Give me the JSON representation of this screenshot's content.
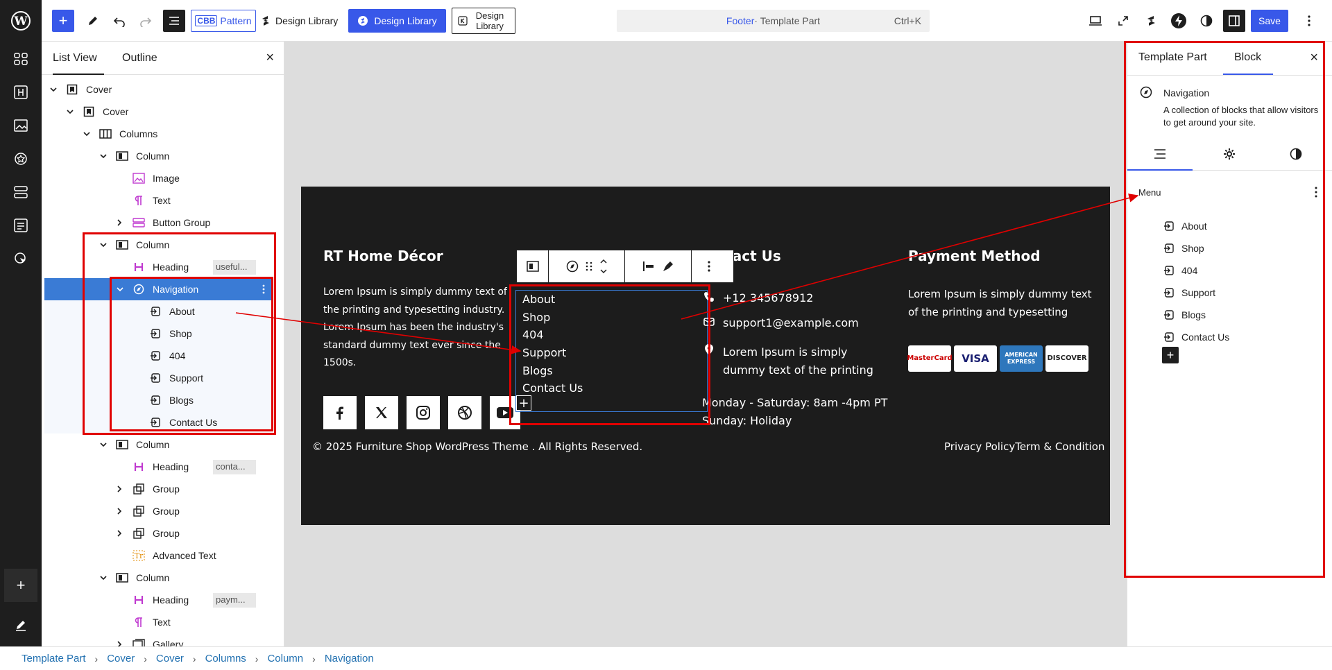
{
  "topbar": {
    "pattern_label": "Pattern",
    "pattern_badge": "CBB",
    "design_library_1": "Design Library",
    "design_library_2": "Design Library",
    "design_library_3": "Design Library",
    "command_template": "Footer",
    "command_suffix": " · Template Part",
    "command_shortcut": "Ctrl+K",
    "save_label": "Save"
  },
  "listview": {
    "tab_list": "List View",
    "tab_outline": "Outline",
    "close": "×",
    "rows": [
      {
        "label": "Cover",
        "depth": 0,
        "chev": "v",
        "icon": "cover"
      },
      {
        "label": "Cover",
        "depth": 1,
        "chev": "v",
        "icon": "cover"
      },
      {
        "label": "Columns",
        "depth": 2,
        "chev": "v",
        "icon": "columns"
      },
      {
        "label": "Column",
        "depth": 3,
        "chev": "v",
        "icon": "column"
      },
      {
        "label": "Image",
        "depth": 4,
        "chev": "",
        "icon": "image"
      },
      {
        "label": "Text",
        "depth": 4,
        "chev": "",
        "icon": "text"
      },
      {
        "label": "Button Group",
        "depth": 4,
        "chev": ">",
        "icon": "buttons"
      },
      {
        "label": "Column",
        "depth": 3,
        "chev": "v",
        "icon": "column"
      },
      {
        "label": "Heading",
        "depth": 4,
        "chev": "",
        "icon": "heading",
        "badge": "useful..."
      },
      {
        "label": "Navigation",
        "depth": 4,
        "chev": "v",
        "icon": "navigation",
        "selected": true
      },
      {
        "label": "About",
        "depth": 5,
        "chev": "",
        "icon": "link",
        "child": true
      },
      {
        "label": "Shop",
        "depth": 5,
        "chev": "",
        "icon": "link",
        "child": true
      },
      {
        "label": "404",
        "depth": 5,
        "chev": "",
        "icon": "link",
        "child": true
      },
      {
        "label": "Support",
        "depth": 5,
        "chev": "",
        "icon": "link",
        "child": true
      },
      {
        "label": "Blogs",
        "depth": 5,
        "chev": "",
        "icon": "link",
        "child": true
      },
      {
        "label": "Contact Us",
        "depth": 5,
        "chev": "",
        "icon": "link",
        "child": true
      },
      {
        "label": "Column",
        "depth": 3,
        "chev": "v",
        "icon": "column"
      },
      {
        "label": "Heading",
        "depth": 4,
        "chev": "",
        "icon": "heading",
        "badge": "conta..."
      },
      {
        "label": "Group",
        "depth": 4,
        "chev": ">",
        "icon": "group"
      },
      {
        "label": "Group",
        "depth": 4,
        "chev": ">",
        "icon": "group"
      },
      {
        "label": "Group",
        "depth": 4,
        "chev": ">",
        "icon": "group"
      },
      {
        "label": "Advanced Text",
        "depth": 4,
        "chev": "",
        "icon": "advtext"
      },
      {
        "label": "Column",
        "depth": 3,
        "chev": "v",
        "icon": "column"
      },
      {
        "label": "Heading",
        "depth": 4,
        "chev": "",
        "icon": "heading",
        "badge": "paym..."
      },
      {
        "label": "Text",
        "depth": 4,
        "chev": "",
        "icon": "text"
      },
      {
        "label": "Gallery",
        "depth": 4,
        "chev": ">",
        "icon": "gallery"
      }
    ]
  },
  "footer": {
    "brand_heading": "RT Home Décor",
    "brand_text": "Lorem Ipsum is simply dummy text of the printing and typesetting industry. Lorem Ipsum has been the industry's standard dummy text ever since the 1500s.",
    "useful_heading_partial": "u",
    "contact_heading": "ntact Us",
    "phone": "+12 345678912",
    "email": "support1@example.com",
    "address": "Lorem Ipsum is simply dummy text of the printing",
    "hours_1": "Monday - Saturday: 8am -4pm PT",
    "hours_2": "Sunday: Holiday",
    "payment_heading": "Payment Method",
    "payment_text": "Lorem Ipsum is simply dummy text of the printing and typesetting",
    "nav_items": [
      "About",
      "Shop",
      "404",
      "Support",
      "Blogs",
      "Contact Us"
    ],
    "copyright": "© 2025 Furniture Shop WordPress Theme . All Rights Reserved.",
    "privacy": "Privacy Policy",
    "terms": "Term & Condition",
    "cards": [
      {
        "name": "MasterCard",
        "bg": "#ffffff",
        "fg": "#cc0000"
      },
      {
        "name": "VISA",
        "bg": "#ffffff",
        "fg": "#1a1f71"
      },
      {
        "name": "AMERICAN EXPRESS",
        "bg": "#2e77bc",
        "fg": "#ffffff"
      },
      {
        "name": "DISCOVER",
        "bg": "#ffffff",
        "fg": "#222222"
      }
    ]
  },
  "settings": {
    "tab_template": "Template Part",
    "tab_block": "Block",
    "close": "×",
    "block_name": "Navigation",
    "block_desc": "A collection of blocks that allow visitors to get around your site.",
    "menu_label": "Menu",
    "menu_items": [
      "About",
      "Shop",
      "404",
      "Support",
      "Blogs",
      "Contact Us"
    ]
  },
  "breadcrumb": [
    "Template Part",
    "Cover",
    "Cover",
    "Columns",
    "Column",
    "Navigation"
  ],
  "colors": {
    "accent": "#3858e9",
    "selected_row": "#3a7bd5",
    "annotation": "#e00000",
    "footer_bg": "#1c1c1c"
  }
}
